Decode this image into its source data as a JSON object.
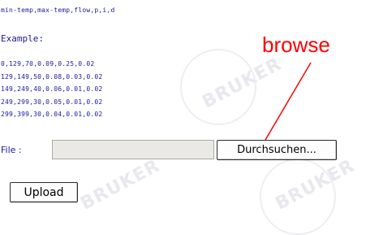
{
  "format_header": "min-temp,max-temp,flow,p,i,d",
  "example_label": "Example:",
  "example_rows": [
    "0,129,70,0.09,0.25,0.02",
    "129,149,50,0.08,0.03,0.02",
    "149,249,40,0.06,0.01,0.02",
    "249,299,30,0.05,0.01,0.02",
    "299,399,30,0.04,0.01,0.02"
  ],
  "file": {
    "label": "File :",
    "value": "",
    "browse_label": "Durchsuchen..."
  },
  "upload_label": "Upload",
  "annotation": {
    "text": "browse",
    "color": "#ff0000"
  },
  "watermark": "BRUKER",
  "colors": {
    "text": "#1a1a9c",
    "input_bg": "#ebe9e5"
  }
}
